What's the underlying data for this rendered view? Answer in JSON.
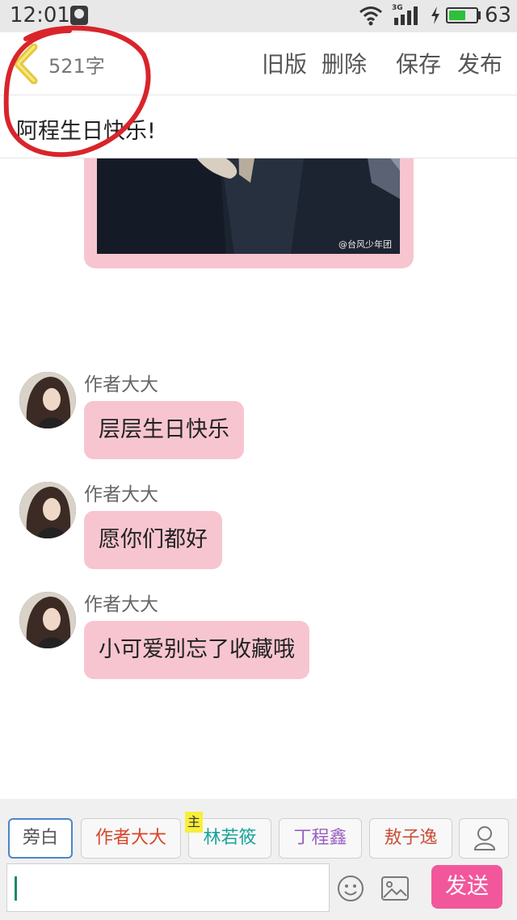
{
  "status": {
    "time": "12:01",
    "network": "3G",
    "battery_level": "63",
    "battery_fraction": 0.63,
    "icons": [
      "notification-icon",
      "wifi-icon",
      "signal-icon",
      "charging-icon",
      "battery-icon"
    ]
  },
  "editor": {
    "word_count": "521字",
    "actions": {
      "old_version": "旧版",
      "delete": "删除",
      "save": "保存",
      "publish": "发布"
    },
    "title": "阿程生日快乐!"
  },
  "image_card": {
    "watermark": "@台风少年团"
  },
  "messages": [
    {
      "sender": "作者大大",
      "text": "层层生日快乐"
    },
    {
      "sender": "作者大大",
      "text": "愿你们都好"
    },
    {
      "sender": "作者大大",
      "text": "小可爱别忘了收藏哦"
    }
  ],
  "roles": [
    {
      "name": "旁白",
      "color": "#555555"
    },
    {
      "name": "作者大大",
      "color": "#d9452b"
    },
    {
      "name": "林若筱",
      "color": "#1aa39a",
      "tag": "主"
    },
    {
      "name": "丁程鑫",
      "color": "#9a5fc0"
    },
    {
      "name": "敖子逸",
      "color": "#c9503a"
    }
  ],
  "composer": {
    "value": "",
    "send_label": "发送"
  },
  "colors": {
    "bubble": "#f7c5d0",
    "send": "#f2579c",
    "annotation": "#d9242b"
  }
}
